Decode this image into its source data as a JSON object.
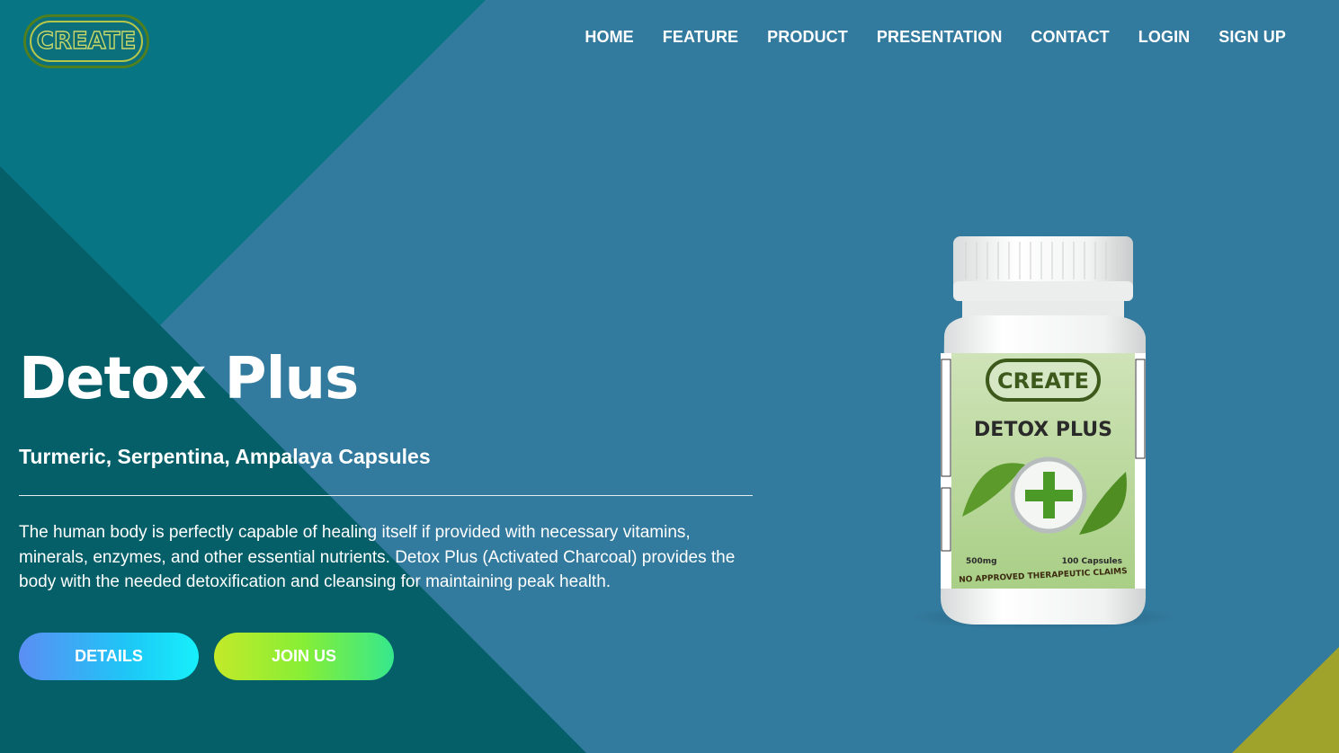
{
  "brand": {
    "logo_text": "CREATE"
  },
  "nav": {
    "items": [
      {
        "label": "HOME"
      },
      {
        "label": "FEATURE"
      },
      {
        "label": "PRODUCT"
      },
      {
        "label": "PRESENTATION"
      },
      {
        "label": "CONTACT"
      },
      {
        "label": "LOGIN"
      },
      {
        "label": "SIGN UP"
      }
    ]
  },
  "hero": {
    "title": "Detox Plus",
    "subtitle": "Turmeric, Serpentina, Ampalaya Capsules",
    "description": "The human body is perfectly capable of healing itself if provided with necessary vitamins, minerals, enzymes, and other essential nutrients. Detox Plus (Activated Charcoal) provides the body with the needed detoxification and cleansing for maintaining peak health.",
    "buttons": {
      "details": "DETAILS",
      "join": "JOIN US"
    }
  },
  "product": {
    "label_brand": "CREATE",
    "label_name": "DETOX PLUS",
    "dosage": "500mg",
    "count": "100 Capsules",
    "disclaimer": "NO APPROVED THERAPEUTIC CLAIMS"
  },
  "colors": {
    "background": "#327a9e",
    "dark_teal": "#087584",
    "deep_teal": "#045e68",
    "olive_accent": "#9fa32b"
  }
}
